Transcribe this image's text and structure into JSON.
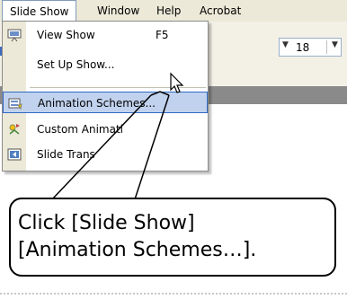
{
  "menubar": {
    "items": [
      "Slide Show",
      "Window",
      "Help",
      "Acrobat"
    ]
  },
  "toolbar": {
    "font_size": "18"
  },
  "menu": {
    "items": [
      {
        "label": "View Show",
        "shortcut": "F5",
        "icon": "projector-icon"
      },
      {
        "label": "Set Up Show...",
        "shortcut": "",
        "icon": ""
      },
      {
        "label": "Animation Schemes...",
        "shortcut": "",
        "icon": "animation-schemes-icon"
      },
      {
        "label": "Custom Animati",
        "shortcut": "",
        "icon": "custom-animation-icon"
      },
      {
        "label": "Slide Trans",
        "shortcut": "",
        "icon": "slide-transition-icon"
      }
    ]
  },
  "callout": {
    "line1": "Click [Slide Show]",
    "line2": "[Animation Schemes…]."
  },
  "colors": {
    "highlight": "#c1d2ee",
    "highlight_border": "#316ac5",
    "menubar": "#ece9d8"
  }
}
